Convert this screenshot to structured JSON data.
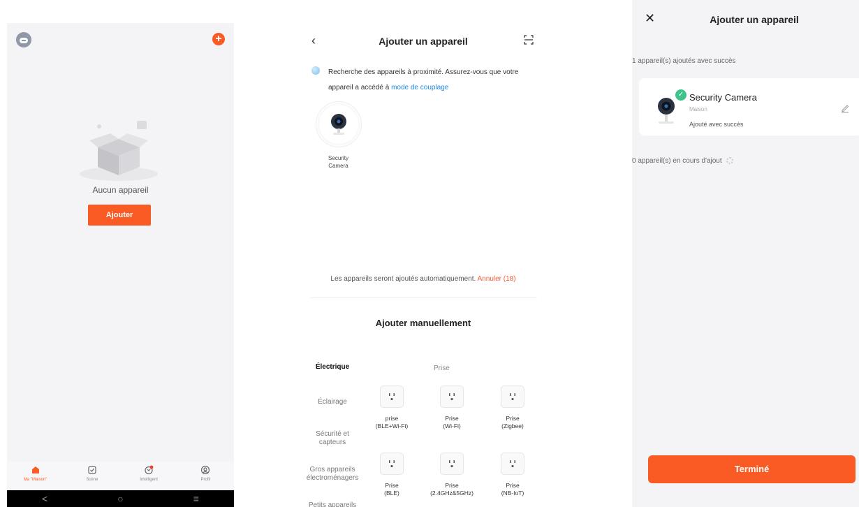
{
  "screen1": {
    "empty_text": "Aucun appareil",
    "add_button": "Ajouter",
    "tabs": [
      {
        "label": "Ma \"Maison\""
      },
      {
        "label": "Scène"
      },
      {
        "label": "Intelligent"
      },
      {
        "label": "Profil"
      }
    ],
    "navbar": {
      "back": "<",
      "home": "○",
      "menu": "≡"
    }
  },
  "screen2": {
    "title": "Ajouter un appareil",
    "search_text": "Recherche des appareils à proximité. Assurez-vous que votre appareil a accédé à ",
    "search_link": "mode de couplage",
    "found_device": {
      "line1": "Security",
      "line2": "Camera"
    },
    "auto_text": "Les appareils seront ajoutés automatiquement. ",
    "cancel_link": "Annuler (18)",
    "manual_title": "Ajouter manuellement",
    "categories": [
      {
        "line1": "Électrique",
        "line2": ""
      },
      {
        "line1": "Éclairage",
        "line2": ""
      },
      {
        "line1": "Sécurité et",
        "line2": "capteurs"
      },
      {
        "line1": "Gros appareils",
        "line2": "électroménagers"
      },
      {
        "line1": "Petits appareils",
        "line2": ""
      }
    ],
    "subcategory_title": "Prise",
    "devices": [
      {
        "line1": "prise",
        "line2": "(BLE+Wi-Fi)"
      },
      {
        "line1": "Prise",
        "line2": "(Wi-Fi)"
      },
      {
        "line1": "Prise",
        "line2": "(Zigbee)"
      },
      {
        "line1": "Prise",
        "line2": "(BLE)"
      },
      {
        "line1": "Prise",
        "line2": "(2.4GHz&5GHz)"
      },
      {
        "line1": "Prise",
        "line2": "(NB-IoT)"
      }
    ]
  },
  "screen3": {
    "title": "Ajouter un appareil",
    "added_section": "1 appareil(s) ajoutés avec succès",
    "device_name": "Security Camera",
    "device_room": "Maison",
    "device_status": "Ajouté avec succès",
    "pending_section": "0 appareil(s) en cours d'ajout",
    "done_button": "Terminé"
  },
  "colors": {
    "accent": "#fa5a23",
    "link": "#1e88e5",
    "success": "#3dc48a",
    "cancel": "#f05a3a"
  },
  "icons": [
    "avatar-icon",
    "plus-icon",
    "back-icon",
    "scan-icon",
    "close-icon",
    "edit-icon",
    "check-icon",
    "home-icon",
    "scene-icon",
    "smart-icon",
    "profile-icon",
    "socket-icon",
    "camera-icon"
  ]
}
